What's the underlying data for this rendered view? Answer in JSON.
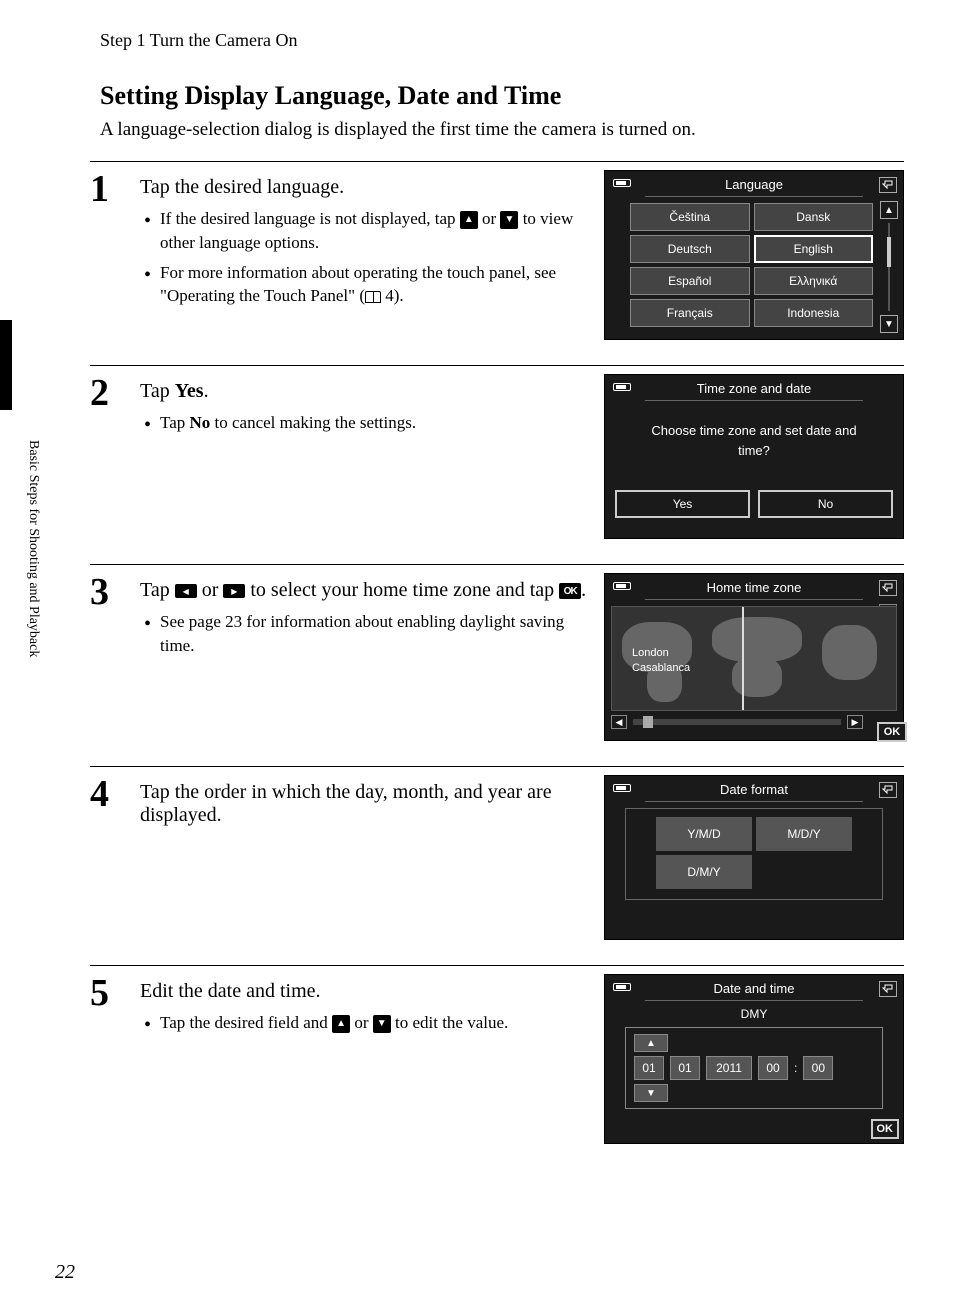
{
  "page_header": "Step 1 Turn the Camera On",
  "main_heading": "Setting Display Language, Date and Time",
  "intro": "A language-selection dialog is displayed the first time the camera is turned on.",
  "sidebar": "Basic Steps for Shooting and Playback",
  "page_number": "22",
  "steps": [
    {
      "n": "1",
      "title_plain": "Tap the desired language.",
      "bullet1a": "If the desired language is not displayed, tap ",
      "bullet1b": " or ",
      "bullet1c": " to view other language options.",
      "bullet2a": "For more information about operating the touch panel, see \"Operating the Touch Panel\" (",
      "bullet2b": " 4)."
    },
    {
      "n": "2",
      "title_a": "Tap ",
      "title_b": "Yes",
      "title_c": ".",
      "bullet1a": "Tap ",
      "bullet1b": "No",
      "bullet1c": " to cancel making the settings."
    },
    {
      "n": "3",
      "title_a": "Tap ",
      "title_b": " or ",
      "title_c": " to select your home time zone and tap ",
      "title_d": ".",
      "bullet1": "See page 23 for information about enabling daylight saving time."
    },
    {
      "n": "4",
      "title": "Tap the order in which the day, month, and year are displayed."
    },
    {
      "n": "5",
      "title": "Edit the date and time.",
      "bullet1a": "Tap the desired field and ",
      "bullet1b": " or ",
      "bullet1c": " to edit the value."
    }
  ],
  "screens": {
    "language": {
      "title": "Language",
      "options": [
        "Čeština",
        "Dansk",
        "Deutsch",
        "English",
        "Español",
        "Ελληνικά",
        "Français",
        "Indonesia"
      ]
    },
    "timezone_confirm": {
      "title": "Time zone and date",
      "message": "Choose time zone and set date and time?",
      "yes": "Yes",
      "no": "No"
    },
    "home_tz": {
      "title": "Home time zone",
      "city1": "London",
      "city2": "Casablanca",
      "ok": "OK"
    },
    "date_format": {
      "title": "Date format",
      "options": [
        "Y/M/D",
        "M/D/Y",
        "D/M/Y"
      ]
    },
    "date_time": {
      "title": "Date and time",
      "order": "DMY",
      "day": "01",
      "month": "01",
      "year": "2011",
      "hour": "00",
      "minute": "00",
      "ok": "OK"
    }
  }
}
